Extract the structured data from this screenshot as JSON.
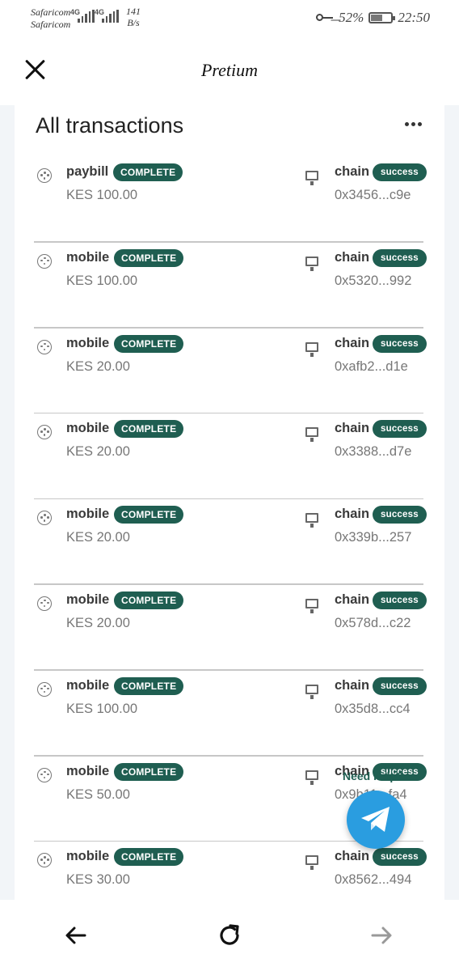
{
  "status_bar": {
    "carrier_1": "Safaricom",
    "carrier_2": "Safaricom",
    "network_1": "4G",
    "network_2": "4G",
    "speed_value": "141",
    "speed_unit": "B/s",
    "battery": "52%",
    "battery_level": 0.52,
    "time": "22:50",
    "icons": [
      "key-icon",
      "battery-icon",
      "signal-icon"
    ]
  },
  "app": {
    "title": "Pretium",
    "close_icon": "close-icon"
  },
  "transactions": {
    "title": "All transactions",
    "menu_icon": "more-icon",
    "items": [
      {
        "type": "paybill",
        "status": "COMPLETE",
        "amount": "KES 100.00",
        "chain_label": "chain",
        "chain_status": "success",
        "hash": "0x3456...c9e"
      },
      {
        "type": "mobile",
        "status": "COMPLETE",
        "amount": "KES 100.00",
        "chain_label": "chain",
        "chain_status": "success",
        "hash": "0x5320...992"
      },
      {
        "type": "mobile",
        "status": "COMPLETE",
        "amount": "KES 20.00",
        "chain_label": "chain",
        "chain_status": "success",
        "hash": "0xafb2...d1e"
      },
      {
        "type": "mobile",
        "status": "COMPLETE",
        "amount": "KES 20.00",
        "chain_label": "chain",
        "chain_status": "success",
        "hash": "0x3388...d7e"
      },
      {
        "type": "mobile",
        "status": "COMPLETE",
        "amount": "KES 20.00",
        "chain_label": "chain",
        "chain_status": "success",
        "hash": "0x339b...257"
      },
      {
        "type": "mobile",
        "status": "COMPLETE",
        "amount": "KES 20.00",
        "chain_label": "chain",
        "chain_status": "success",
        "hash": "0x578d...c22"
      },
      {
        "type": "mobile",
        "status": "COMPLETE",
        "amount": "KES 100.00",
        "chain_label": "chain",
        "chain_status": "success",
        "hash": "0x35d8...cc4"
      },
      {
        "type": "mobile",
        "status": "COMPLETE",
        "amount": "KES 50.00",
        "chain_label": "chain",
        "chain_status": "success",
        "hash": "0x9b11...fa4"
      },
      {
        "type": "mobile",
        "status": "COMPLETE",
        "amount": "KES 30.00",
        "chain_label": "chain",
        "chain_status": "success",
        "hash": "0x8562...494"
      }
    ]
  },
  "help": {
    "label": "Need help?",
    "icon": "telegram-icon"
  },
  "bottom_nav": {
    "back_icon": "arrow-left-icon",
    "reload_icon": "reload-icon",
    "forward_icon": "arrow-right-icon"
  },
  "colors": {
    "badge": "#1f5e51",
    "fab": "#2a9de0",
    "page_bg": "#f2f5f8"
  }
}
